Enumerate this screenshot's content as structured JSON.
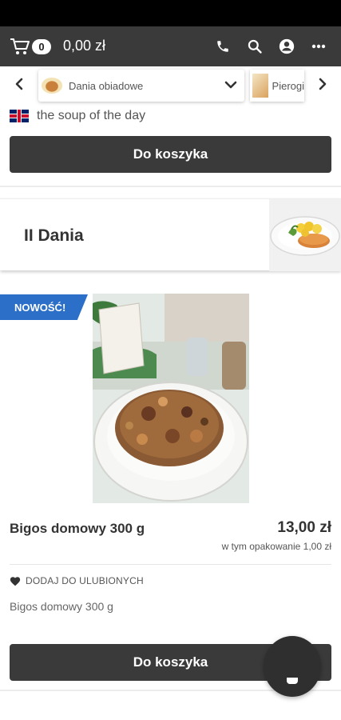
{
  "header": {
    "cart_count": "0",
    "cart_total": "0,00 zł",
    "icons": [
      "cart-icon",
      "phone-icon",
      "search-icon",
      "account-icon",
      "more-icon"
    ]
  },
  "category_nav": {
    "current_label": "Dania obiadowe",
    "next_label": "Pierogi"
  },
  "soup": {
    "text": "the soup of the day",
    "button": "Do koszyka"
  },
  "section": {
    "title": "II Dania"
  },
  "product": {
    "badge": "NOWOŚĆ!",
    "name": "Bigos domowy 300 g",
    "price": "13,00 zł",
    "packaging_note": "w tym opakowanie 1,00 zł",
    "favorite_label": "DODAJ DO ULUBIONYCH",
    "description": "Bigos domowy 300 g",
    "button": "Do koszyka"
  },
  "colors": {
    "header_bg": "#3a3a3a",
    "button_bg": "#3a3a3a",
    "badge_bg": "#2b6fc9"
  }
}
